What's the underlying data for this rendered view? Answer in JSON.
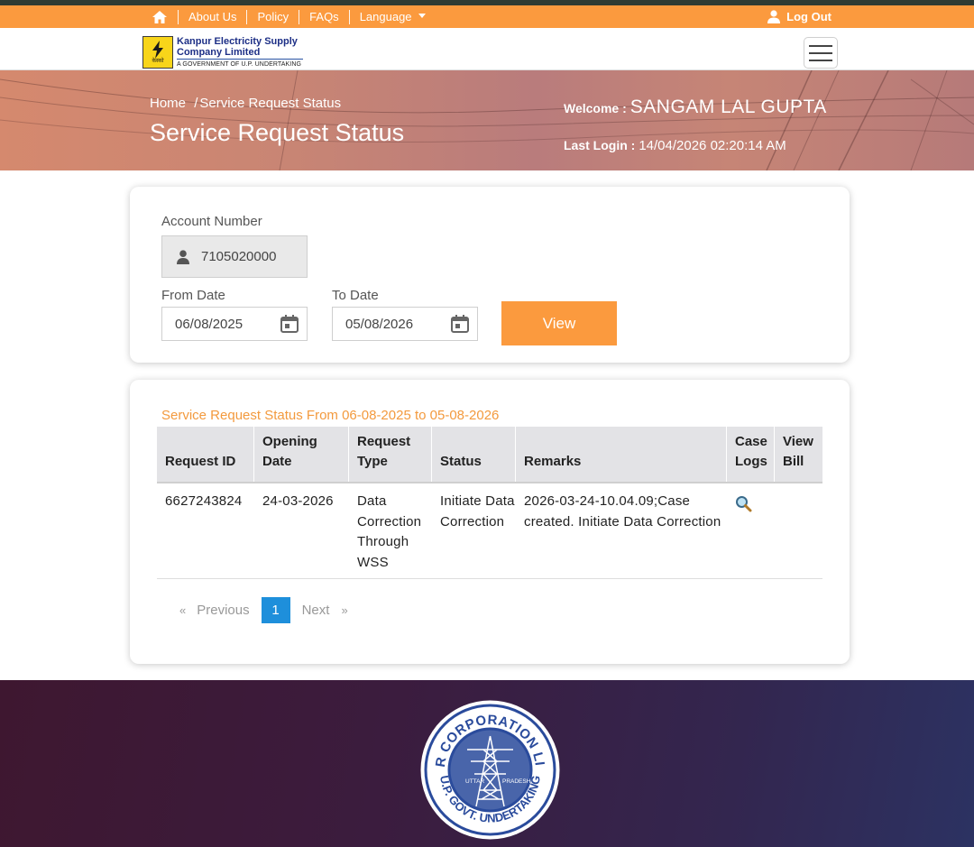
{
  "topbar": {
    "about": "About Us",
    "policy": "Policy",
    "faqs": "FAQs",
    "language": "Language",
    "logout": "Log Out"
  },
  "logo": {
    "name_line1": "Kanpur Electricity Supply",
    "name_line2": "Company Limited",
    "tagline": "A GOVERNMENT OF U.P. UNDERTAKING",
    "mark_text": "केस्को"
  },
  "banner": {
    "breadcrumb_home": "Home",
    "breadcrumb_sep": "/",
    "breadcrumb_current": "Service Request Status",
    "title": "Service Request Status",
    "welcome_label": "Welcome :",
    "welcome_name": "SANGAM LAL GUPTA",
    "last_login_label": "Last Login :",
    "last_login_value": "14/04/2026 02:20:14 AM"
  },
  "form": {
    "account_label": "Account Number",
    "account_value": "7105020000",
    "from_label": "From Date",
    "from_value": "06/08/2025",
    "to_label": "To Date",
    "to_value": "05/08/2026",
    "view_button": "View"
  },
  "results": {
    "title": "Service Request Status From 06-08-2025 to 05-08-2026",
    "headers": [
      "Request ID",
      "Opening Date",
      "Request Type",
      "Status",
      "Remarks",
      "Case Logs",
      "View Bill"
    ],
    "rows": [
      {
        "request_id": "6627243824",
        "opening_date": "24-03-2026",
        "request_type": "Data Correction Through WSS",
        "status": "Initiate Data Correction",
        "remarks": "2026-03-24-10.04.09;Case created. Initiate Data Correction",
        "case_logs_icon": "magnifier-icon",
        "view_bill": ""
      }
    ]
  },
  "pagination": {
    "first": "«",
    "previous": "Previous",
    "current": "1",
    "next": "Next",
    "last": "»"
  },
  "footer": {
    "seal_top": "POWER CORPORATION LIMITED",
    "seal_bottom": "U.P. GOVT. UNDERTAKING",
    "seal_left": "UTTAR",
    "seal_right": "PRADESH"
  },
  "colors": {
    "accent_orange": "#fb9a3e",
    "pager_blue": "#1e8fdb",
    "footer_dark": "#3b1c3e"
  }
}
